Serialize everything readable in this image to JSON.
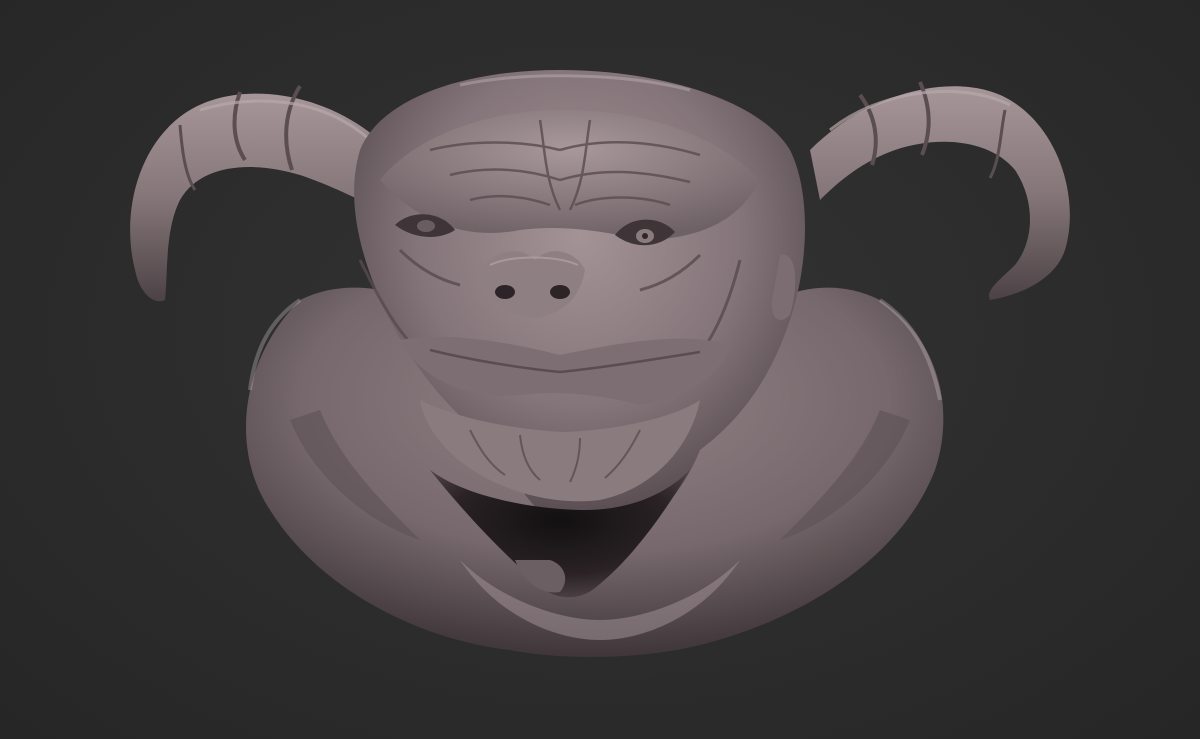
{
  "scene": {
    "subject": "demon-head-sculpt",
    "colors": {
      "background": "#2b2b2b",
      "clay_light": "#9e8e92",
      "clay_mid": "#7a6c70",
      "clay_dark": "#463b3f",
      "cavity": "#1f1a1c"
    }
  }
}
